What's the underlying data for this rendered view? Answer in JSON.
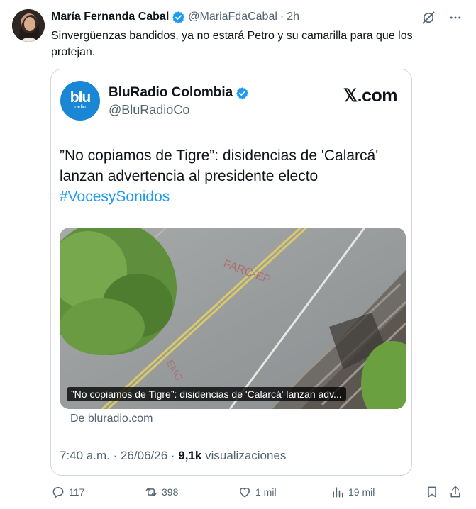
{
  "author": {
    "name": "María Fernanda Cabal",
    "handle": "@MariaFdaCabal",
    "separator": "·",
    "time_ago": "2h"
  },
  "tweet": {
    "text": "Sinvergüenzas bandidos, ya no estará Petro y su camarilla para que los protejan."
  },
  "card": {
    "logo_text": "blu",
    "logo_sub": "radio",
    "name": "BluRadio Colombia",
    "handle": "@BluRadioCo",
    "site": "𝕏.com",
    "headline": "”No copiamos de Tigre”: disidencias de 'Calarcá' lanzan advertencia al presidente electo",
    "hashtag": "#VocesySonidos",
    "image_caption": "”No copiamos de Tigre”: disidencias de 'Calarcá' lanzan adv...",
    "source": "De bluradio.com",
    "time": "7:40 a.m. · 26/06/26 · ",
    "views_count": "9,1k",
    "views_label": " visualizaciones"
  },
  "actions": {
    "replies": "117",
    "retweets": "398",
    "likes": "1 mil",
    "views": "19 mil"
  },
  "colors": {
    "accent": "#1d9bf0",
    "muted": "#536471",
    "text": "#0f1419",
    "border": "#cfd9de"
  }
}
